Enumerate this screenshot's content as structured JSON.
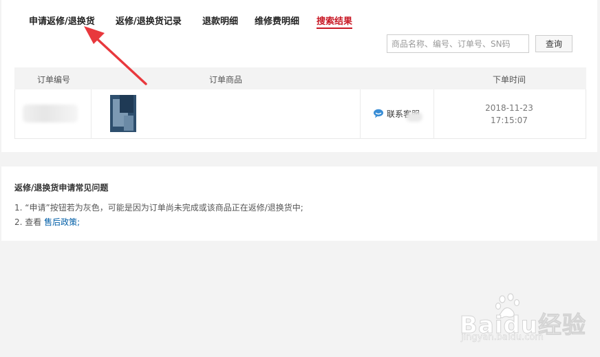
{
  "tabs": [
    {
      "label": "申请返修/退换货",
      "active": false
    },
    {
      "label": "返修/退换货记录",
      "active": false
    },
    {
      "label": "退款明细",
      "active": false
    },
    {
      "label": "维修费明细",
      "active": false
    },
    {
      "label": "搜索结果",
      "active": true
    }
  ],
  "search": {
    "placeholder": "商品名称、编号、订单号、SN码",
    "button_label": "查询"
  },
  "table": {
    "columns": [
      "订单编号",
      "订单商品",
      "下单时间"
    ],
    "rows": [
      {
        "contact_label": "联系客服",
        "date": "2018-11-23",
        "time": "17:15:07"
      }
    ]
  },
  "faq": {
    "title": "返修/退换货申请常见问题",
    "item1": "1. “申请”按钮若为灰色，可能是因为订单尚未完成或该商品正在返修/退换货中;",
    "item2_prefix": "2. 查看",
    "item2_link": "售后政策;"
  },
  "watermark": {
    "text": "Baidu经验",
    "url": "jingyan.baidu.com"
  },
  "colors": {
    "accent": "#c81623",
    "link": "#005ea7",
    "arrow": "#e8383d"
  },
  "icons": {
    "contact": "chat-bubble-icon",
    "arrow": "red-arrow-annotation"
  }
}
